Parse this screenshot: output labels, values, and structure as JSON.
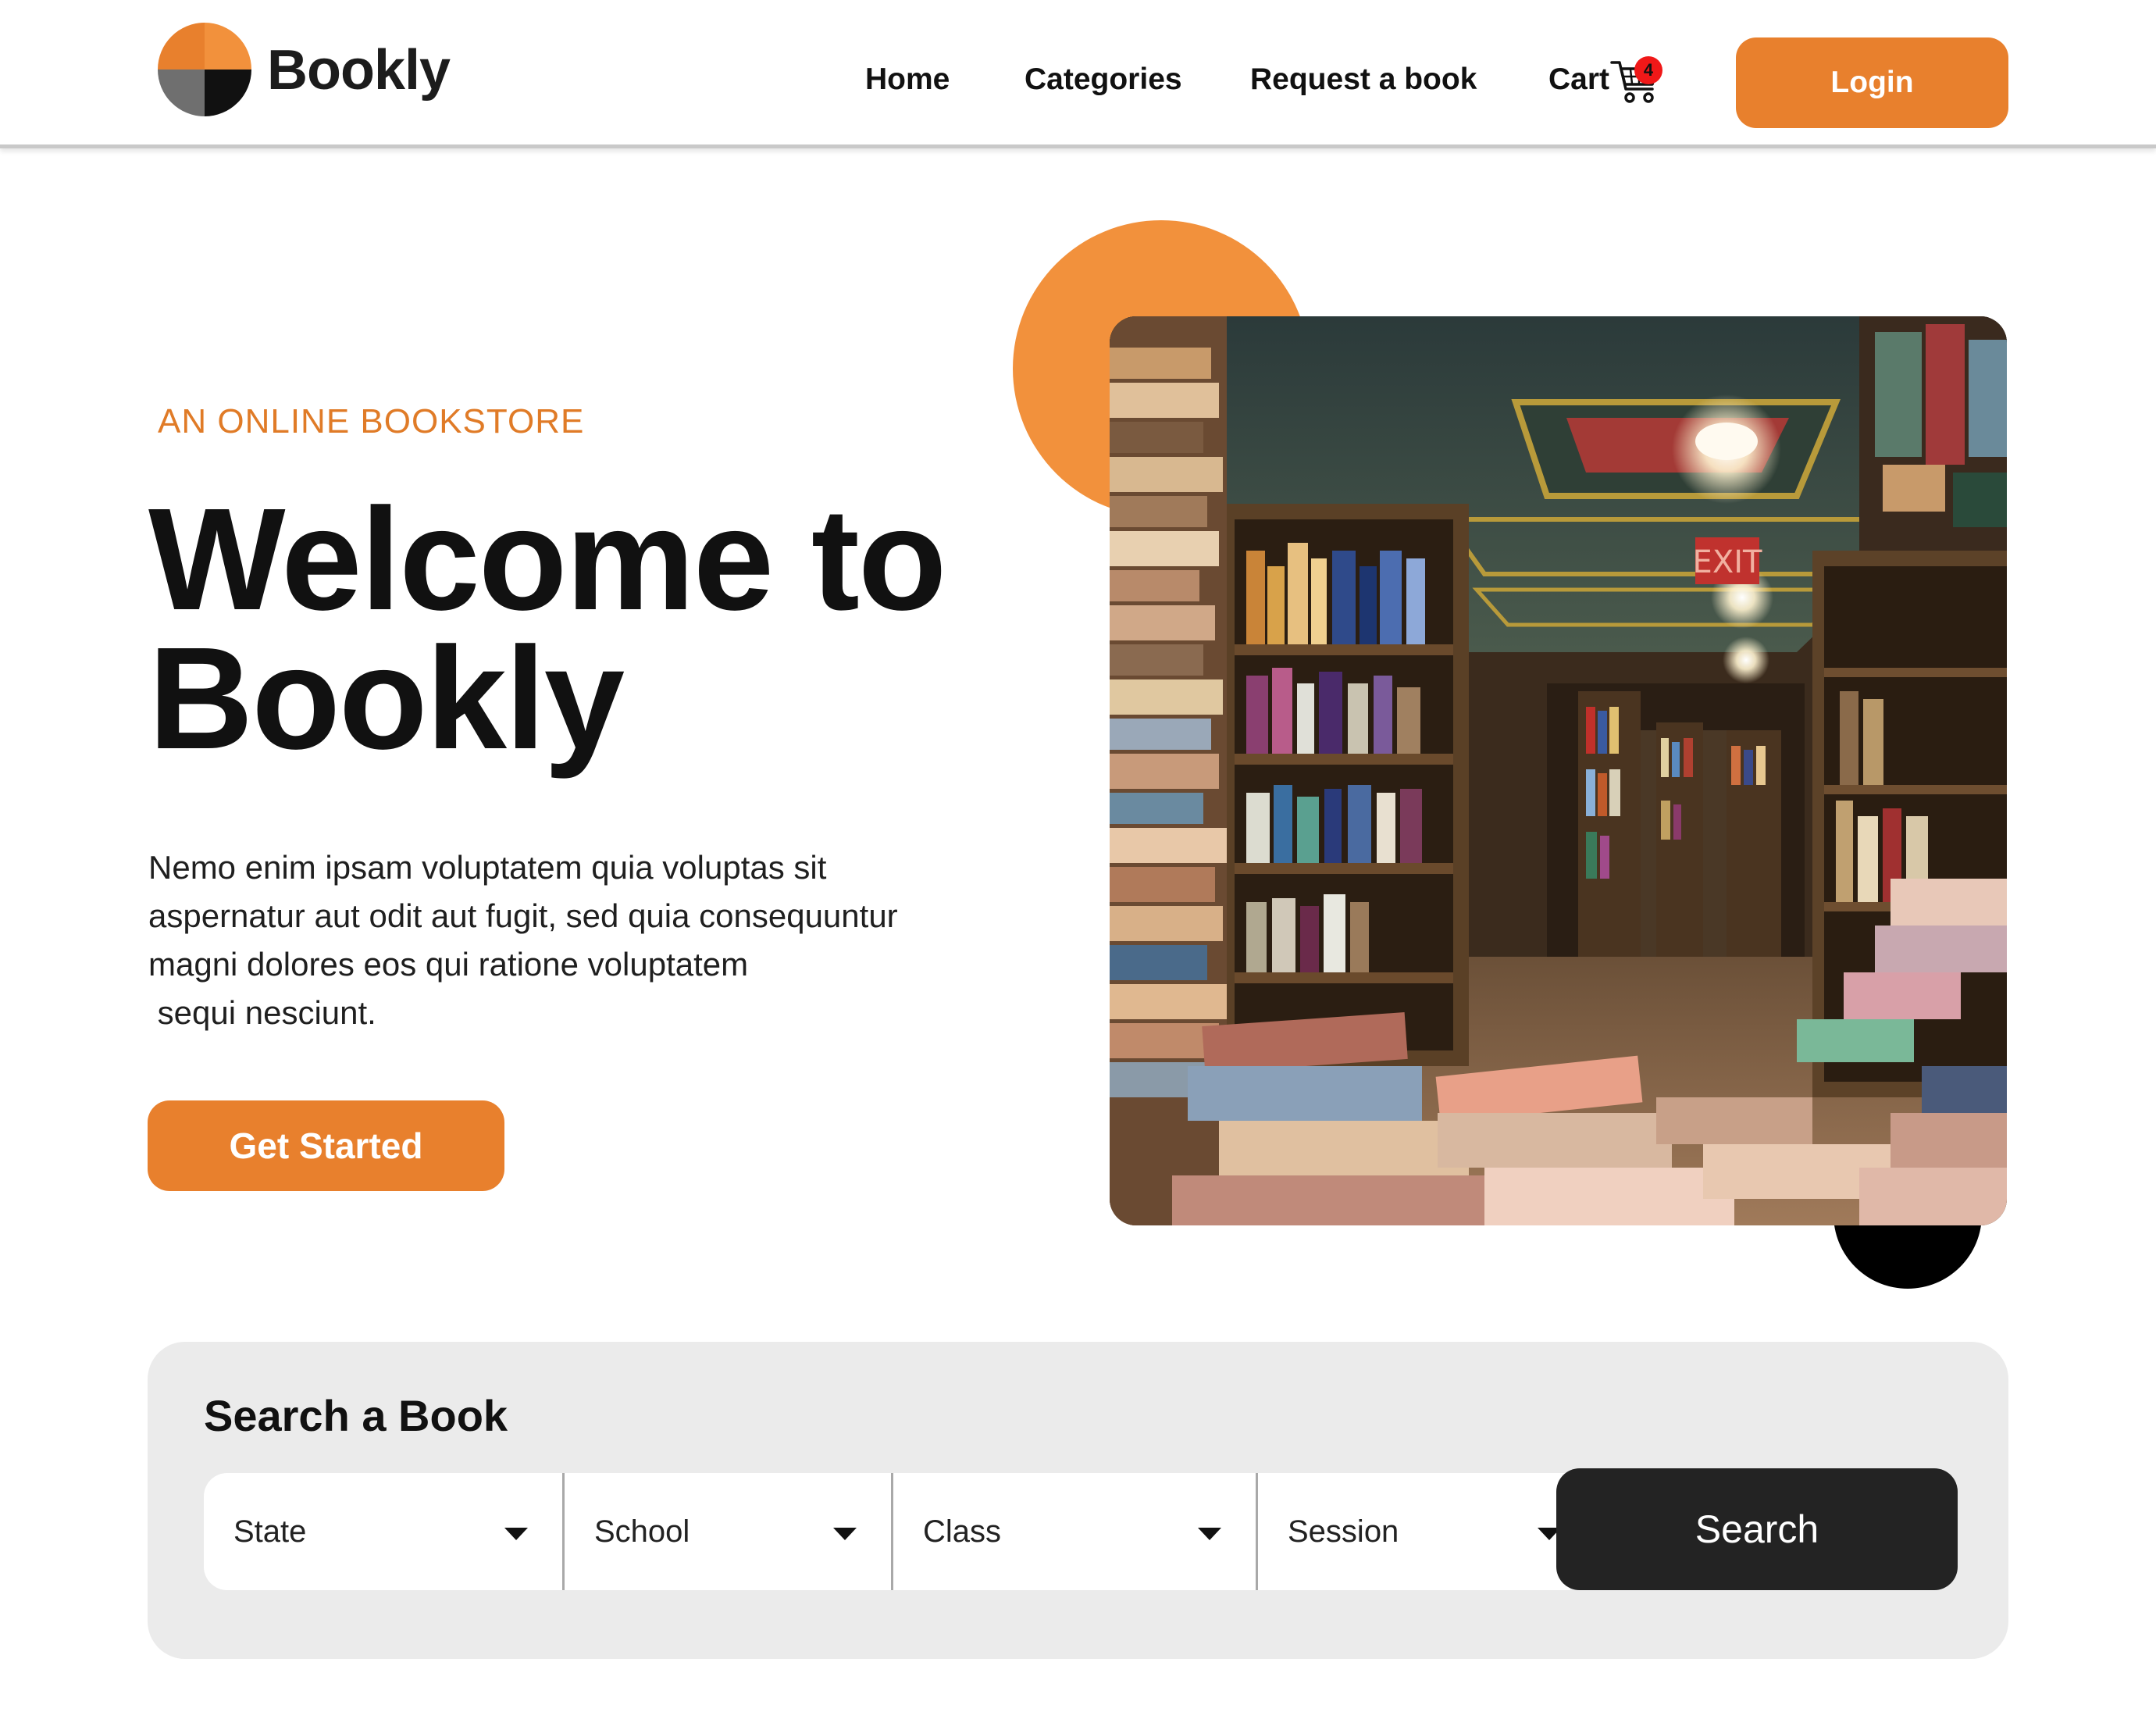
{
  "header": {
    "brand": "Bookly",
    "nav": {
      "home": "Home",
      "categories": "Categories",
      "request": "Request a book",
      "cart": "Cart"
    },
    "cart_count": "4",
    "login_label": "Login"
  },
  "hero": {
    "eyebrow": "AN ONLINE BOOKSTORE",
    "title_line1": "Welcome to",
    "title_line2": "Bookly",
    "description_lines": [
      "Nemo enim ipsam voluptatem quia voluptas sit",
      "aspernatur aut odit aut fugit, sed quia consequuntur",
      "magni dolores eos qui ratione voluptatem",
      " sequi nesciunt."
    ],
    "cta_label": "Get Started",
    "image_sign": "EXIT"
  },
  "search": {
    "title": "Search a Book",
    "filters": {
      "state": "State",
      "school": "School",
      "class": "Class",
      "session": "Session"
    },
    "button_label": "Search"
  },
  "icons": {
    "logo": "bookly-logo-icon",
    "cart": "shopping-cart-icon",
    "dropdown": "caret-down-icon"
  },
  "colors": {
    "accent": "#e8802d",
    "accent_light": "#f2913c",
    "dark_button": "#232323",
    "panel_bg": "#ebebeb",
    "badge": "#f01818"
  }
}
